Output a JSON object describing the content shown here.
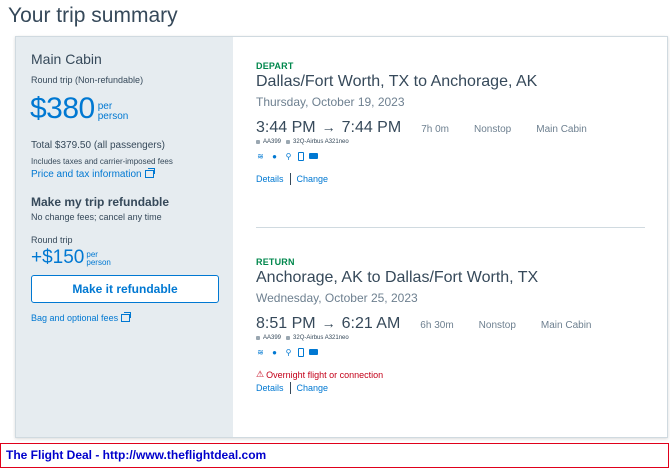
{
  "page_title": "Your trip summary",
  "fare": {
    "cabin": "Main Cabin",
    "trip_type": "Round trip (Non-refundable)",
    "price": "$380",
    "per_line1": "per",
    "per_line2": "person",
    "total": "Total $379.50 (all passengers)",
    "includes": "Includes taxes and carrier-imposed fees",
    "price_tax_link": "Price and tax information",
    "refund_title": "Make my trip refundable",
    "refund_desc": "No change fees; cancel any time",
    "refund_trip_label": "Round trip",
    "refund_price": "+$150",
    "refund_per1": "per",
    "refund_per2": "person",
    "refund_button": "Make it refundable",
    "bag_link": "Bag and optional fees"
  },
  "legs": [
    {
      "label": "DEPART",
      "route": "Dallas/Fort Worth, TX to Anchorage, AK",
      "date": "Thursday, October 19, 2023",
      "depart_time": "3:44 PM",
      "arrow": "→",
      "arrive_time": "7:44 PM",
      "duration": "7h 0m",
      "stops": "Nonstop",
      "cabin": "Main Cabin",
      "flight": "AA399",
      "aircraft": "32Q-Airbus A321neo",
      "details": "Details",
      "change": "Change"
    },
    {
      "label": "RETURN",
      "route": "Anchorage, AK to Dallas/Fort Worth, TX",
      "date": "Wednesday, October 25, 2023",
      "depart_time": "8:51 PM",
      "arrow": "→",
      "arrive_time": "6:21 AM",
      "duration": "6h 30m",
      "stops": "Nonstop",
      "cabin": "Main Cabin",
      "flight": "AA399",
      "aircraft": "32Q-Airbus A321neo",
      "warning": "Overnight flight or connection",
      "details": "Details",
      "change": "Change"
    }
  ],
  "amenity_icons": [
    "wifi-icon",
    "power-icon",
    "usb-icon",
    "phone-icon",
    "tv-icon"
  ],
  "footer": "The Flight Deal - http://www.theflightdeal.com",
  "colors": {
    "link": "#0078d2",
    "leg_label": "#00874c",
    "warning": "#c30019",
    "footer_text": "#0000cc",
    "footer_border": "#e0001b",
    "left_panel": "#e6ecf0"
  }
}
